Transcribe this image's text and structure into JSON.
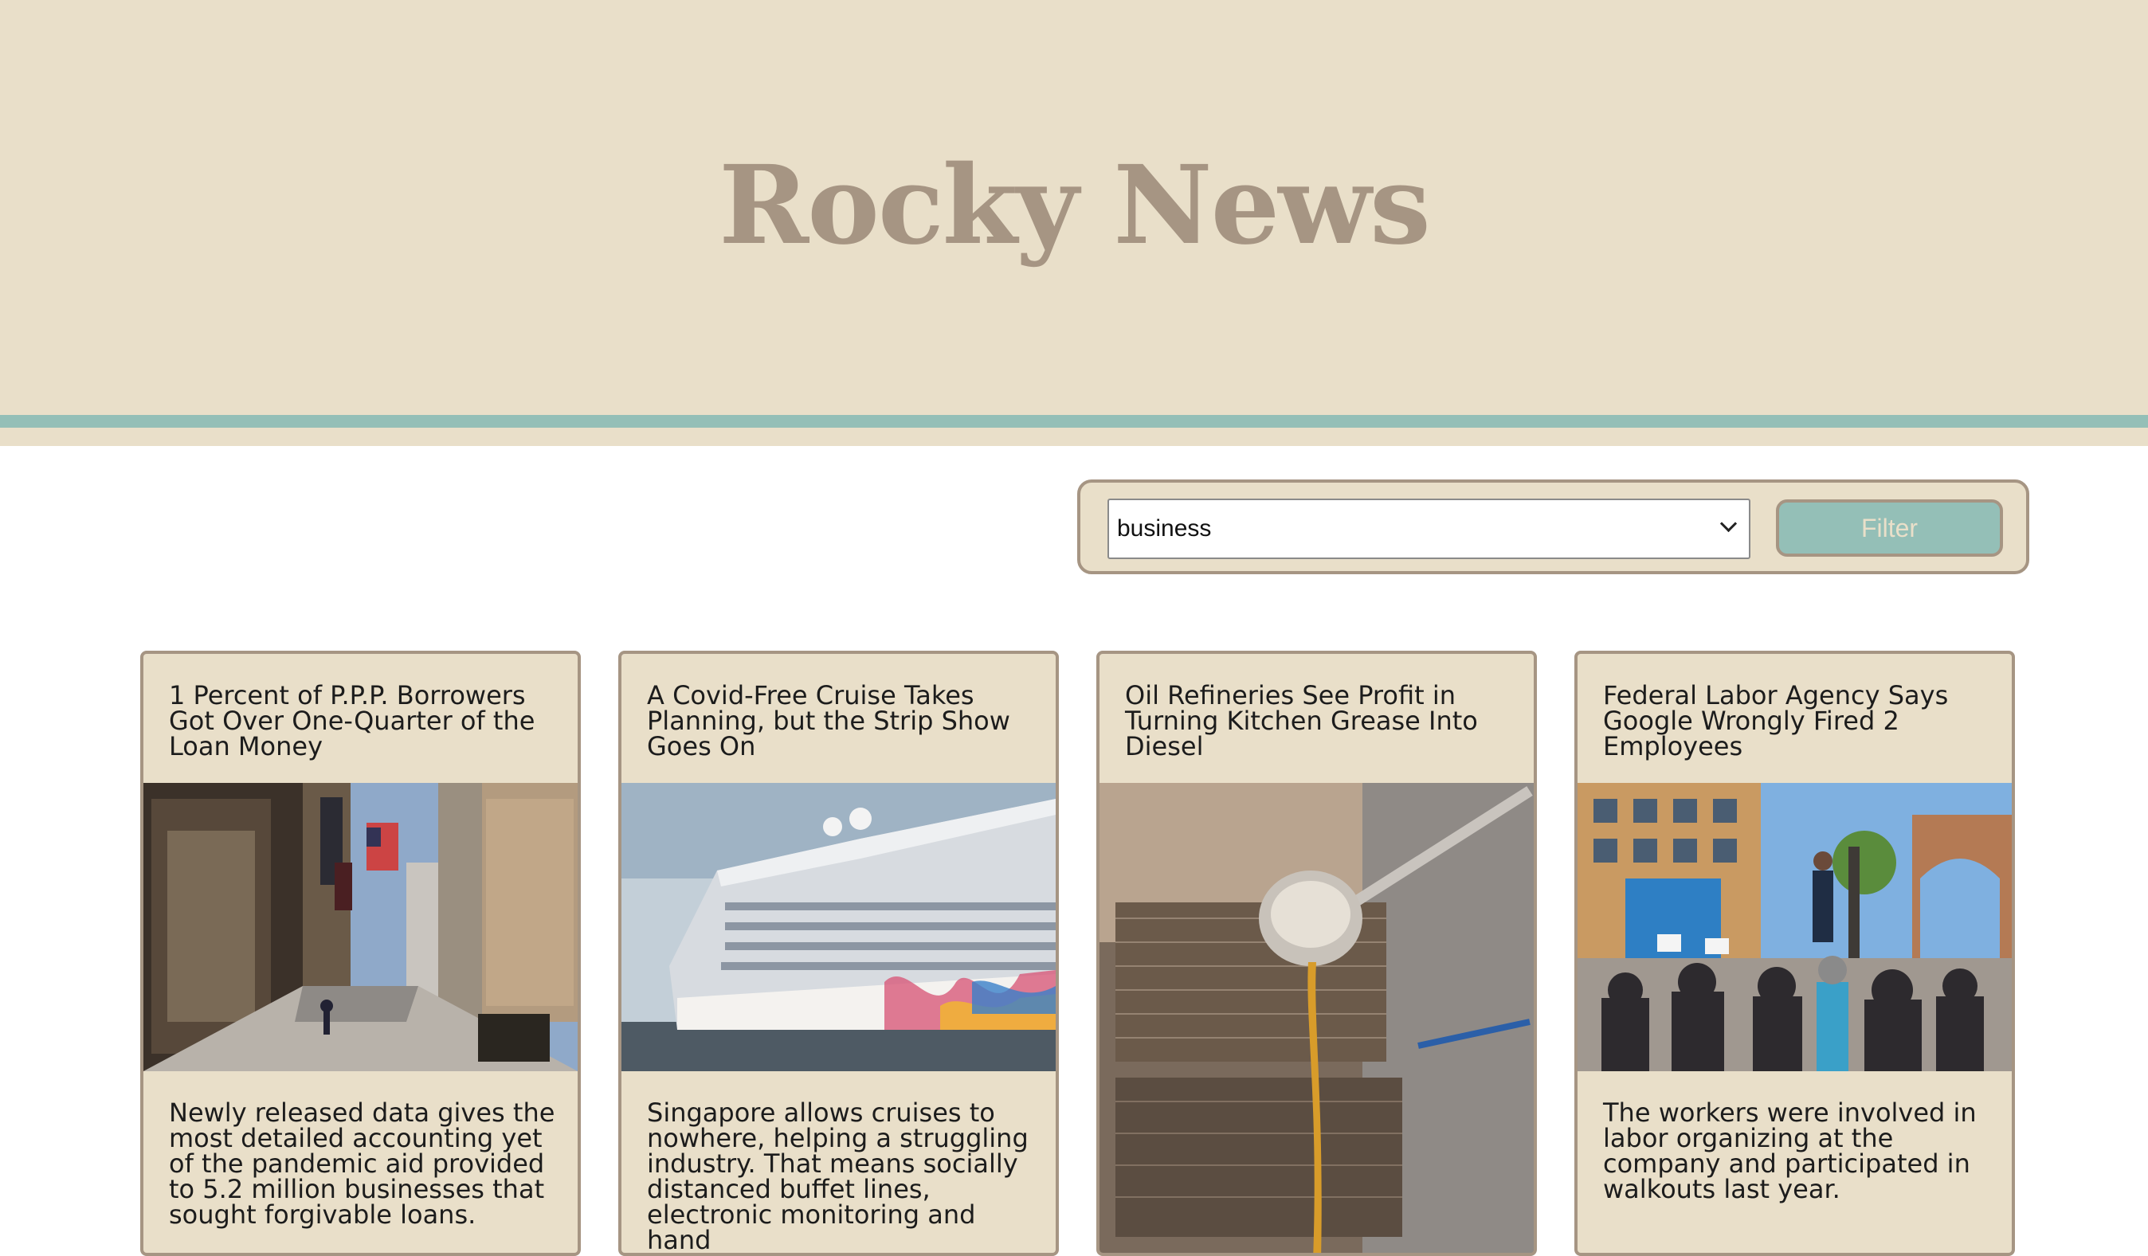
{
  "header": {
    "site_title": "Rocky News"
  },
  "filter": {
    "selected_category": "business",
    "button_label": "Filter"
  },
  "articles": [
    {
      "title": "1 Percent of P.P.P. Borrowers Got Over One-Quarter of the Loan Money",
      "summary": "Newly released data gives the most detailed accounting yet of the pandemic aid provided to 5.2 million businesses that sought forgivable loans.",
      "image": "city-street-photo"
    },
    {
      "title": "A Covid-Free Cruise Takes Planning, but the Strip Show Goes On",
      "summary": "Singapore allows cruises to nowhere, helping a struggling industry. That means socially distanced buffet lines, electronic monitoring and hand",
      "image": "cruise-ship-photo"
    },
    {
      "title": "Oil Refineries See Profit in Turning Kitchen Grease Into Diesel",
      "summary": "",
      "image": "fryer-ladle-photo"
    },
    {
      "title": "Federal Labor Agency Says Google Wrongly Fired 2 Employees",
      "summary": "The workers were involved in labor organizing at the company and participated in walkouts last year.",
      "image": "protest-crowd-photo"
    }
  ],
  "colors": {
    "cream": "#e9dfc9",
    "taupe": "#a69583",
    "teal": "#94bfb7"
  }
}
